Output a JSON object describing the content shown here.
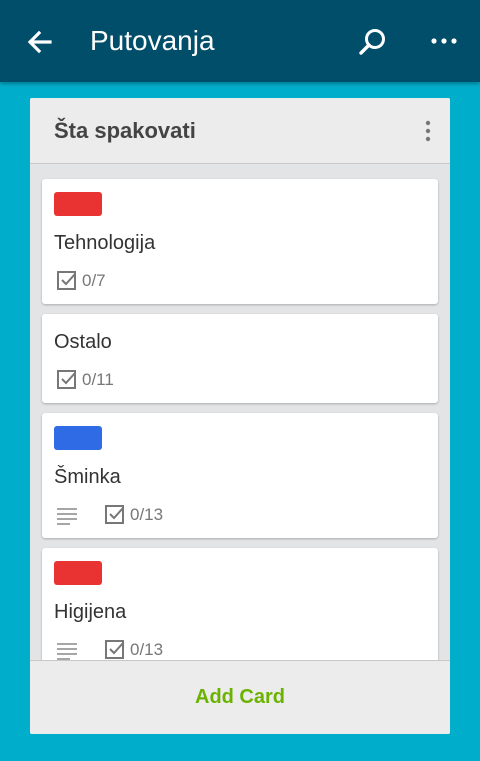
{
  "appbar": {
    "title": "Putovanja",
    "back_icon": "arrow-left-icon",
    "search_icon": "search-icon",
    "more_icon": "more-horizontal-icon",
    "color": "#004e6a"
  },
  "board_background": "#00aecc",
  "list": {
    "title": "Šta spakovati",
    "menu_icon": "more-vertical-icon",
    "cards": [
      {
        "label_color": "#e93232",
        "title": "Tehnologija",
        "checklist": "0/7",
        "has_description": false
      },
      {
        "label_color": null,
        "title": "Ostalo",
        "checklist": "0/11",
        "has_description": false
      },
      {
        "label_color": "#2f6be4",
        "title": "Šminka",
        "checklist": "0/13",
        "has_description": true
      },
      {
        "label_color": "#e93232",
        "title": "Higijena",
        "checklist": "0/13",
        "has_description": true
      }
    ],
    "add_card_label": "Add Card",
    "add_card_color": "#6cb200"
  }
}
